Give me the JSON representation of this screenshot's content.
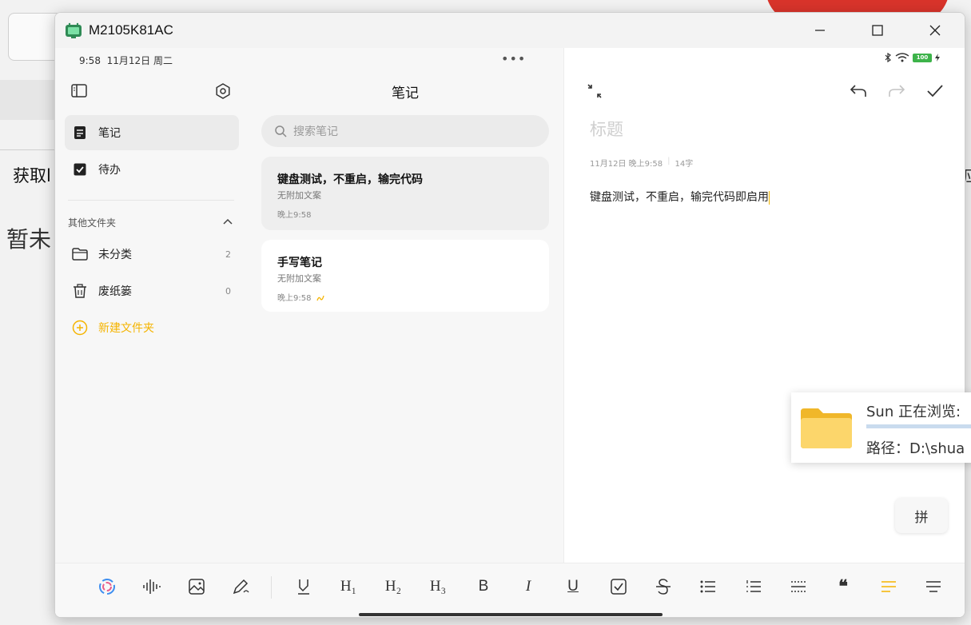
{
  "background": {
    "text_left_1": "获取l",
    "text_left_2": "暂未",
    "text_right": "应"
  },
  "window": {
    "title": "M2105K81AC"
  },
  "status_bar": {
    "time": "9:58",
    "date": "11月12日 周二",
    "menu_dots": "•••",
    "battery": "100"
  },
  "sidebar": {
    "items": [
      {
        "label": "笔记",
        "icon": "note-icon"
      },
      {
        "label": "待办",
        "icon": "checkbox-icon"
      }
    ],
    "section_title": "其他文件夹",
    "folders": [
      {
        "label": "未分类",
        "count": "2",
        "icon": "folder-icon"
      },
      {
        "label": "废纸篓",
        "count": "0",
        "icon": "trash-icon"
      }
    ],
    "new_folder": "新建文件夹"
  },
  "notes_list": {
    "title": "笔记",
    "search_placeholder": "搜索笔记",
    "notes": [
      {
        "title": "键盘测试，不重启，输完代码",
        "subtitle": "无附加文案",
        "time": "晚上9:58"
      },
      {
        "title": "手写笔记",
        "subtitle": "无附加文案",
        "time": "晚上9:58"
      }
    ]
  },
  "editor": {
    "title_placeholder": "标题",
    "meta_date": "11月12日 晚上9:58",
    "meta_sep": "|",
    "meta_count": "14字",
    "body": "键盘测试，不重启，输完代码即启用"
  },
  "toolbar": {
    "h1": "H₁",
    "h2": "H₂",
    "h3": "H₃",
    "bold": "B",
    "italic": "I",
    "underline": "U",
    "quote": "❝"
  },
  "ime": {
    "label": "拼"
  },
  "notification": {
    "line1": "Sun  正在浏览:",
    "line2": "路径：D:\\shua"
  },
  "colors": {
    "accent": "#f5b400",
    "window_bg": "#ffffff",
    "sidebar_bg": "#f7f7f7"
  }
}
